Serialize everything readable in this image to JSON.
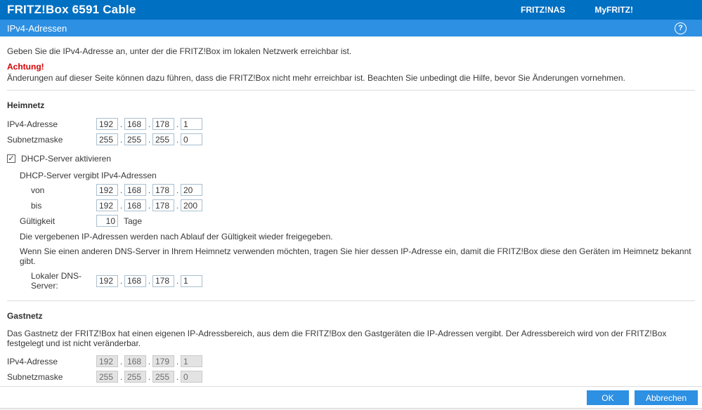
{
  "header": {
    "window_title": "FRITZ!Box 6591 Cable",
    "nav": {
      "fritznas": "FRITZ!NAS",
      "myfritz": "MyFRITZ!"
    },
    "page_title": "IPv4-Adressen",
    "help_glyph": "?"
  },
  "colors": {
    "top_bar": "#0070c2",
    "sub_bar": "#2e90e2",
    "warning_red": "#d40000",
    "button_blue": "#2e90e2"
  },
  "ui": {
    "dot": ".",
    "checkmark": "✓"
  },
  "intro": {
    "line1": "Geben Sie die IPv4-Adresse an, unter der die FRITZ!Box im lokalen Netzwerk erreichbar ist.",
    "warning_title": "Achtung!",
    "warning_text": "Änderungen auf dieser Seite können dazu führen, dass die FRITZ!Box nicht mehr erreichbar ist. Beachten Sie unbedingt die Hilfe, bevor Sie Änderungen vornehmen."
  },
  "heimnetz": {
    "heading": "Heimnetz",
    "ipv4_label": "IPv4-Adresse",
    "ipv4": [
      "192",
      "168",
      "178",
      "1"
    ],
    "subnet_label": "Subnetzmaske",
    "subnet": [
      "255",
      "255",
      "255",
      "0"
    ],
    "dhcp_checkbox_label": "DHCP-Server aktivieren",
    "dhcp_checked": "checked",
    "dhcp_range_label": "DHCP-Server vergibt IPv4-Adressen",
    "von_label": "von",
    "von": [
      "192",
      "168",
      "178",
      "20"
    ],
    "bis_label": "bis",
    "bis": [
      "192",
      "168",
      "178",
      "200"
    ],
    "validity_label": "Gültigkeit",
    "validity_value": "10",
    "validity_unit": "Tage",
    "note_release": "Die vergebenen IP-Adressen werden nach Ablauf der Gültigkeit wieder freigegeben.",
    "note_dns": "Wenn Sie einen anderen DNS-Server in Ihrem Heimnetz verwenden möchten, tragen Sie hier dessen IP-Adresse ein, damit die FRITZ!Box diese den Geräten im Heimnetz bekannt gibt.",
    "dns_label": "Lokaler DNS-Server:",
    "dns": [
      "192",
      "168",
      "178",
      "1"
    ]
  },
  "gastnetz": {
    "heading": "Gastnetz",
    "description": "Das Gastnetz der FRITZ!Box hat einen eigenen IP-Adressbereich, aus dem die FRITZ!Box den Gastgeräten die IP-Adressen vergibt. Der Adressbereich wird von der FRITZ!Box festgelegt und ist nicht veränderbar.",
    "ipv4_label": "IPv4-Adresse",
    "ipv4": [
      "192",
      "168",
      "179",
      "1"
    ],
    "subnet_label": "Subnetzmaske",
    "subnet": [
      "255",
      "255",
      "255",
      "0"
    ]
  },
  "footer": {
    "ok_label": "OK",
    "cancel_label": "Abbrechen"
  }
}
